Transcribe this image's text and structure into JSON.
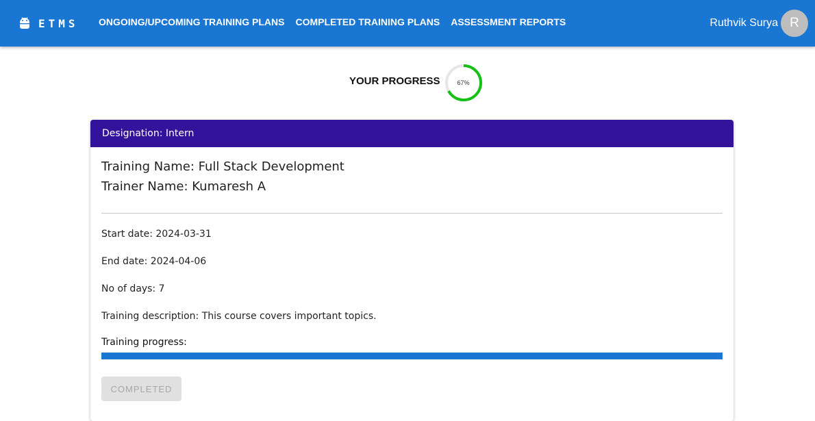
{
  "header": {
    "brand": "ETMS",
    "nav": [
      "ONGOING/UPCOMING TRAINING PLANS",
      "COMPLETED TRAINING PLANS",
      "ASSESSMENT REPORTS"
    ],
    "user_name": "Ruthvik Surya",
    "avatar_initial": "R",
    "brand_icon": "android-icon",
    "color": "#1976d2"
  },
  "progress": {
    "label": "YOUR PROGRESS",
    "percent_text": "67%",
    "value": 0.67,
    "ring_color": "#14c014",
    "track_color": "#e6e6e6"
  },
  "card": {
    "header_color": "#33139b",
    "designation": "Designation: Intern",
    "training_name": "Training Name: Full Stack Development",
    "trainer_name": "Trainer Name: Kumaresh A",
    "start_date": "Start date: 2024-03-31",
    "end_date": "End date: 2024-04-06",
    "num_days": "No of days: 7",
    "description": "Training description: This course covers important topics.",
    "progress_label": "Training progress:",
    "progress_value": 1.0,
    "button_label": "COMPLETED"
  }
}
